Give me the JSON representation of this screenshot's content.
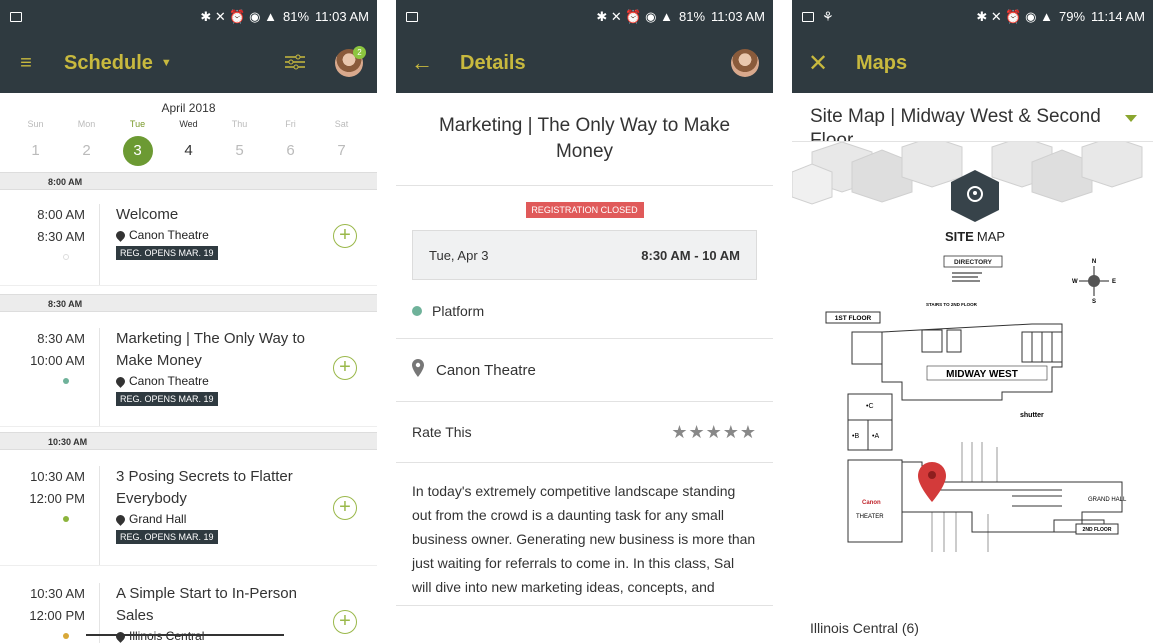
{
  "panel1": {
    "status": {
      "icons": "✱ ✕ ⏰ ◉ ▲",
      "battery": "81%",
      "time": "11:03 AM"
    },
    "app_title": "Schedule",
    "avatar_badge": "2",
    "month": "April 2018",
    "days": [
      {
        "name": "Sun",
        "num": "1"
      },
      {
        "name": "Mon",
        "num": "2"
      },
      {
        "name": "Tue",
        "num": "3"
      },
      {
        "name": "Wed",
        "num": "4"
      },
      {
        "name": "Thu",
        "num": "5"
      },
      {
        "name": "Fri",
        "num": "6"
      },
      {
        "name": "Sat",
        "num": "7"
      }
    ],
    "time_headers": [
      "8:00 AM",
      "8:30 AM",
      "10:30 AM"
    ],
    "sessions": [
      {
        "start": "8:00 AM",
        "end": "8:30 AM",
        "title": "Welcome",
        "location": "Canon Theatre",
        "badge": "REG. OPENS MAR. 19",
        "dot_color": "#ffffff"
      },
      {
        "start": "8:30 AM",
        "end": "10:00 AM",
        "title": "Marketing | The Only Way to Make Money",
        "location": "Canon Theatre",
        "badge": "REG. OPENS MAR. 19",
        "dot_color": "#6fb29a"
      },
      {
        "start": "10:30 AM",
        "end": "12:00 PM",
        "title": "3 Posing Secrets to Flatter Everybody",
        "location": "Grand Hall",
        "badge": "REG. OPENS MAR. 19",
        "dot_color": "#8cb43c"
      },
      {
        "start": "10:30 AM",
        "end": "12:00 PM",
        "title": "A Simple Start to In-Person Sales",
        "location": "Illinois Central",
        "badge": "",
        "dot_color": "#d8a838"
      }
    ]
  },
  "panel2": {
    "status": {
      "icons": "✱ ✕ ⏰ ◉ ▲",
      "battery": "81%",
      "time": "11:03 AM"
    },
    "app_title": "Details",
    "session_title": "Marketing | The Only Way to Make Money",
    "registration_status": "REGISTRATION CLOSED",
    "date": "Tue, Apr 3",
    "time_range": "8:30 AM - 10 AM",
    "track": "Platform",
    "location": "Canon Theatre",
    "rate_label": "Rate This",
    "stars": "★★★★★",
    "description": "In today's extremely competitive landscape standing out from the crowd is a daunting task for any small business owner. Generating new business is more than just waiting for referrals to come in. In this class, Sal will dive into new marketing ideas, concepts, and execution plans"
  },
  "panel3": {
    "status": {
      "icons": "✱ ✕ ⏰ ◉ ▲",
      "battery": "79%",
      "time": "11:14 AM"
    },
    "app_title": "Maps",
    "map_select": "Site Map | Midway West & Second Floor",
    "map": {
      "site_map_bold": "SITE",
      "site_map_light": "MAP",
      "directory": "DIRECTORY",
      "first_floor": "1ST FLOOR",
      "midway_west": "MIDWAY WEST",
      "grand_hall": "GRAND HALL",
      "theater": "THEATER",
      "canon": "Canon",
      "second_floor": "2ND FLOOR",
      "shutter": "shutter",
      "room_c": "•C",
      "room_b": "•B",
      "room_a": "•A",
      "compass_n": "N",
      "compass_e": "E",
      "compass_s": "S",
      "compass_w": "W",
      "stairs": "STAIRS TO 2ND FLOOR"
    },
    "list_item": "Illinois Central (6)"
  },
  "colors": {
    "appbar": "#2f3a40",
    "accent": "#c8b93e",
    "green": "#6c9a33",
    "closed": "#e05a5a"
  }
}
